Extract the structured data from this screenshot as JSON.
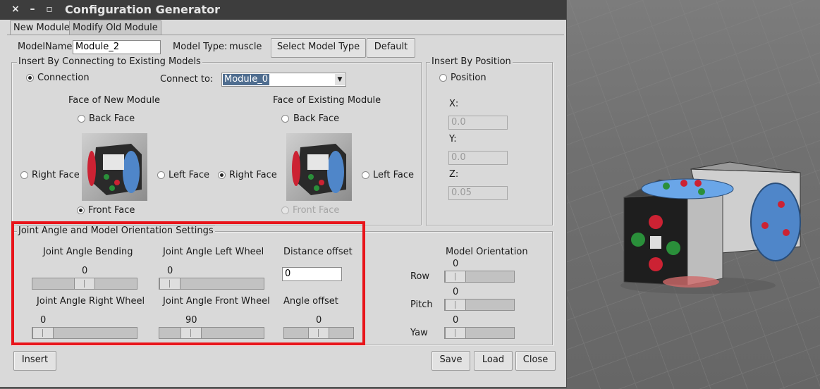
{
  "window": {
    "title": "Configuration Generator",
    "controls": [
      "×",
      "–",
      "▫"
    ]
  },
  "tabs": [
    {
      "label": "New Module",
      "active": true
    },
    {
      "label": "Modify Old Module",
      "active": false
    }
  ],
  "top": {
    "model_name_label": "ModelName:",
    "model_name_value": "Module_2",
    "model_type_label": "Model Type:",
    "model_type_value": "muscle",
    "select_model_type": "Select Model Type",
    "default": "Default"
  },
  "connect_frame": {
    "title": "Insert By Connecting to Existing Models",
    "connection_label": "Connection",
    "connect_to_label": "Connect to:",
    "connect_to_value": "Module_0",
    "new_face_title": "Face of New Module",
    "existing_face_title": "Face of Existing Module",
    "new_faces": {
      "back": "Back Face",
      "right": "Right Face",
      "left": "Left Face",
      "front": "Front Face",
      "selected": "front"
    },
    "existing_faces": {
      "back": "Back Face",
      "right": "Right Face",
      "left": "Left Face",
      "front": "Front Face",
      "selected": "right"
    }
  },
  "position_frame": {
    "title": "Insert By Position",
    "position_label": "Position",
    "x_label": "X:",
    "x_value": "0.0",
    "y_label": "Y:",
    "y_value": "0.0",
    "z_label": "Z:",
    "z_value": "0.05"
  },
  "joint_frame": {
    "title": "Joint Angle and Model Orientation Settings",
    "bending_label": "Joint Angle Bending",
    "bending_value": "0",
    "bending_fraction": 0.5,
    "left_wheel_label": "Joint Angle Left Wheel",
    "left_wheel_value": "0",
    "left_wheel_fraction": 0.0,
    "distance_label": "Distance offset",
    "distance_value": "0",
    "right_wheel_label": "Joint Angle Right Wheel",
    "right_wheel_value": "0",
    "right_wheel_fraction": 0.0,
    "front_wheel_label": "Joint Angle Front Wheel",
    "front_wheel_value": "90",
    "front_wheel_fraction": 0.25,
    "angle_offset_label": "Angle offset",
    "angle_offset_value": "0",
    "angle_offset_fraction": 0.5
  },
  "orientation": {
    "title": "Model Orientation",
    "row_label": "Row",
    "row_value": "0",
    "pitch_label": "Pitch",
    "pitch_value": "0",
    "yaw_label": "Yaw",
    "yaw_value": "0"
  },
  "bottom": {
    "insert": "Insert",
    "save": "Save",
    "load": "Load",
    "close": "Close"
  },
  "colors": {
    "highlight": "#e8141a",
    "selection": "#4f6d8f",
    "titlebar": "#3d3d3d"
  }
}
